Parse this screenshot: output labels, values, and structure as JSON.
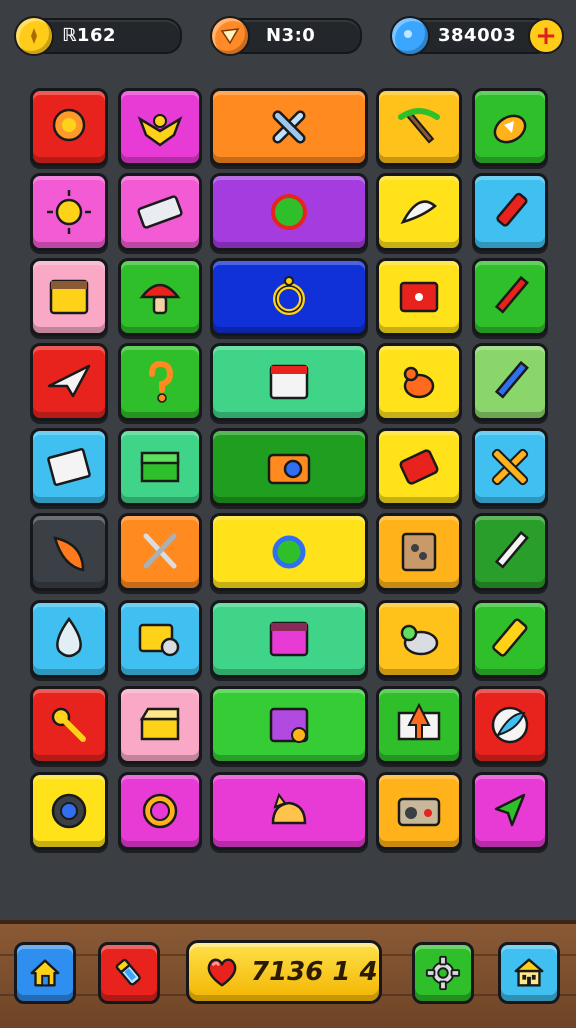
{
  "hud": {
    "gold_amount": "ℝ162",
    "coin_amount": "N3:0",
    "gems_amount": "384003",
    "gold_icon": "gold-coin-icon",
    "coin_icon": "bronze-coin-icon",
    "gem_icon": "blue-gem-icon",
    "plus_symbol": "+"
  },
  "grid": {
    "tiles": [
      {
        "icon": "badge-icon",
        "color": "#e8231e"
      },
      {
        "icon": "eagle-emblem-icon",
        "color": "#e83bd6"
      },
      {
        "icon": "crossed-bones-icon",
        "color": "#ff8a1f"
      },
      {
        "icon": "pickaxe-icon",
        "color": "#ffc21a"
      },
      {
        "icon": "paint-leaf-icon",
        "color": "#2fbf2a"
      },
      {
        "icon": "sun-icon",
        "color": "#f25bd4"
      },
      {
        "icon": "keyboard-icon",
        "color": "#f25bd4"
      },
      {
        "icon": "no-leaf-icon",
        "color": "#a43ce0"
      },
      {
        "icon": "rocket-icon",
        "color": "#ffe21a"
      },
      {
        "icon": "marker-pen-icon",
        "color": "#3fc0f0"
      },
      {
        "icon": "calendar-icon",
        "color": "#f9a9c6"
      },
      {
        "icon": "mushroom-icon",
        "color": "#2fbf2a"
      },
      {
        "icon": "ring-icon",
        "color": "#1030d8"
      },
      {
        "icon": "photo-card-icon",
        "color": "#ffe21a"
      },
      {
        "icon": "pencil-icon",
        "color": "#2fbf2a"
      },
      {
        "icon": "paper-plane-icon",
        "color": "#e8231e"
      },
      {
        "icon": "question-icon",
        "color": "#2fbf2a"
      },
      {
        "icon": "calendar-sheet-icon",
        "color": "#3fd488"
      },
      {
        "icon": "chicken-icon",
        "color": "#ffe21a"
      },
      {
        "icon": "blue-pencil-icon",
        "color": "#8ad66a"
      },
      {
        "icon": "notepad-icon",
        "color": "#3fc0f0"
      },
      {
        "icon": "treasure-box-icon",
        "color": "#3fd488"
      },
      {
        "icon": "camera-icon",
        "color": "#1f9e1f"
      },
      {
        "icon": "phone-icon",
        "color": "#ffe21a"
      },
      {
        "icon": "x-mark-icon",
        "color": "#3fc0f0"
      },
      {
        "icon": "carrot-icon",
        "color": "#3b4046"
      },
      {
        "icon": "tools-icon",
        "color": "#ff8a1f"
      },
      {
        "icon": "refresh-ring-icon",
        "color": "#ffe21a"
      },
      {
        "icon": "speaker-box-icon",
        "color": "#ffb21a"
      },
      {
        "icon": "brush-pen-icon",
        "color": "#2a9e2a"
      },
      {
        "icon": "water-drop-icon",
        "color": "#3fc0f0"
      },
      {
        "icon": "photo-gallery-icon",
        "color": "#3fc0f0"
      },
      {
        "icon": "planner-icon",
        "color": "#3fd488"
      },
      {
        "icon": "bird-icon",
        "color": "#ffc21a"
      },
      {
        "icon": "battery-icon",
        "color": "#2fbf2a"
      },
      {
        "icon": "key-icon",
        "color": "#e8231e"
      },
      {
        "icon": "chest-icon",
        "color": "#f9a9c6"
      },
      {
        "icon": "schedule-icon",
        "color": "#35cc35"
      },
      {
        "icon": "arrow-flag-icon",
        "color": "#2fbf2a"
      },
      {
        "icon": "feather-icon",
        "color": "#e8231e"
      },
      {
        "icon": "tire-icon",
        "color": "#ffe21a"
      },
      {
        "icon": "gear-sun-icon",
        "color": "#e83bd6"
      },
      {
        "icon": "dog-face-icon",
        "color": "#e83bd6"
      },
      {
        "icon": "radio-icon",
        "color": "#ffb21a"
      },
      {
        "icon": "cursor-arrow-icon",
        "color": "#e83bd6"
      }
    ]
  },
  "bottom_nav": {
    "home_icon": "home-icon",
    "shop_icon": "tube-icon",
    "heart_icon": "heart-icon",
    "score_value": "7136 1 4",
    "settings_icon": "gear-icon",
    "town_icon": "town-hall-icon"
  }
}
